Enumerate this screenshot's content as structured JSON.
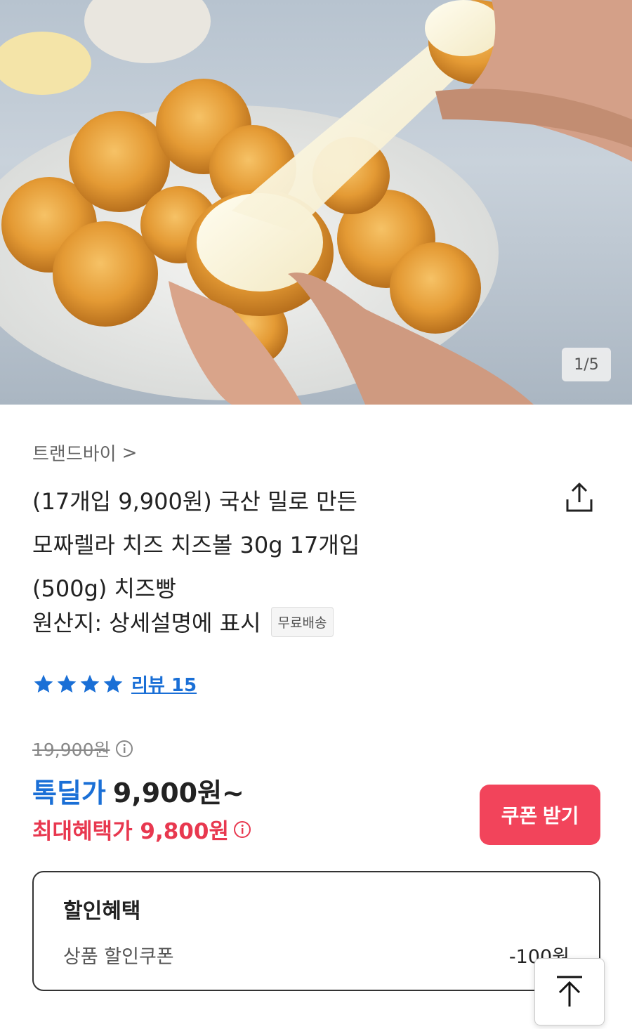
{
  "hero": {
    "counter": "1/5"
  },
  "seller": {
    "name": "트랜드바이",
    "chevron": ">"
  },
  "product": {
    "title_lines": [
      "(17개입 9,900원) 국산 밀로 만든",
      "모짜렐라 치즈 치즈볼 30g 17개입",
      "(500g) 치즈빵"
    ],
    "origin": "원산지: 상세설명에 표시",
    "shipping_badge": "무료배송"
  },
  "rating": {
    "stars": 4,
    "review_label": "리뷰 15"
  },
  "price": {
    "original": "19,900원",
    "deal_label": "톡딜가",
    "deal_price": "9,900원~",
    "max_benefit": "최대혜택가 9,800원"
  },
  "coupon_button": "쿠폰 받기",
  "discount": {
    "title": "할인혜택",
    "item_label": "상품 할인쿠폰",
    "item_value": "-100원"
  },
  "icons": {
    "share": "share-icon",
    "info": "info-icon",
    "scroll_top": "arrow-up-icon",
    "star": "star-icon"
  },
  "colors": {
    "accent_blue": "#1a6fd6",
    "accent_red": "#e8384f",
    "coupon_bg": "#f2445b"
  }
}
